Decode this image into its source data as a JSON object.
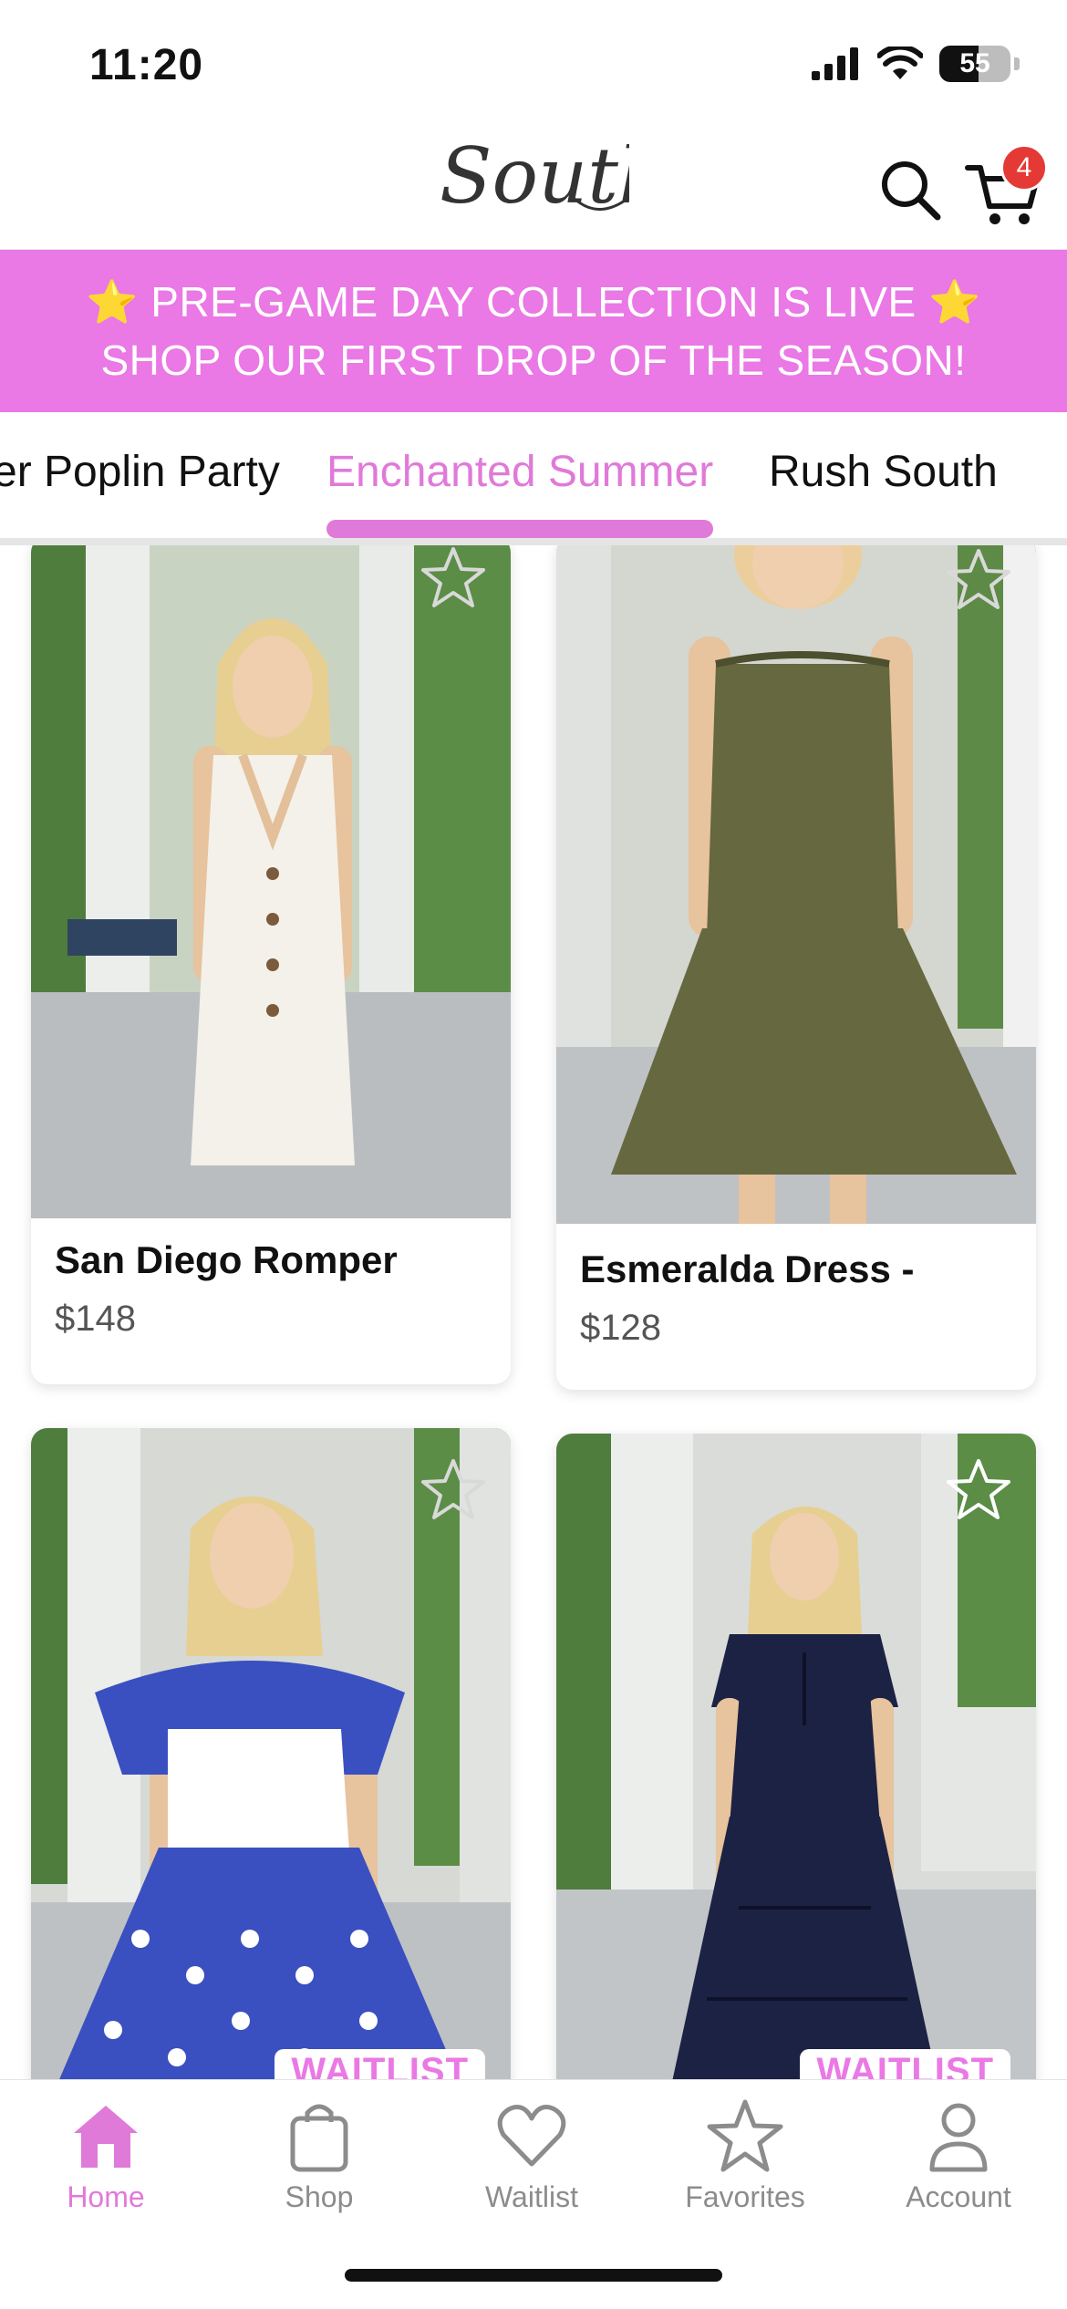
{
  "status_bar": {
    "time": "11:20",
    "battery": "55"
  },
  "header": {
    "logo": "South",
    "cart_count": "4"
  },
  "promo": {
    "line1": "PRE-GAME DAY COLLECTION IS LIVE",
    "line2": "SHOP OUR FIRST DROP OF THE SEASON!",
    "star_glyph": "⭐"
  },
  "tabs": [
    {
      "label": "er Poplin Party",
      "active": false
    },
    {
      "label": "Enchanted Summer",
      "active": true
    },
    {
      "label": "Rush South",
      "active": false
    }
  ],
  "products": [
    {
      "name": "San Diego Romper",
      "price": "$148",
      "dress_color": "#f4f1ea",
      "favorited": false
    },
    {
      "name": "Esmeralda Dress -",
      "price": "$128",
      "dress_color": "#66683f",
      "favorited": false
    },
    {
      "name": "",
      "price": "",
      "badge": "WAITLIST",
      "dress_color": "#3a4fc0",
      "favorited": false
    },
    {
      "name": "",
      "price": "",
      "badge": "WAITLIST",
      "dress_color": "#1c2244",
      "favorited": false
    }
  ],
  "tabbar": [
    {
      "label": "Home",
      "icon": "home-icon",
      "active": true
    },
    {
      "label": "Shop",
      "icon": "shopping-bag-icon",
      "active": false
    },
    {
      "label": "Waitlist",
      "icon": "heart-icon",
      "active": false
    },
    {
      "label": "Favorites",
      "icon": "star-icon",
      "active": false
    },
    {
      "label": "Account",
      "icon": "person-icon",
      "active": false
    }
  ],
  "colors": {
    "accent": "#e07ad9",
    "banner": "#ea78e5",
    "badge": "#e53935"
  }
}
